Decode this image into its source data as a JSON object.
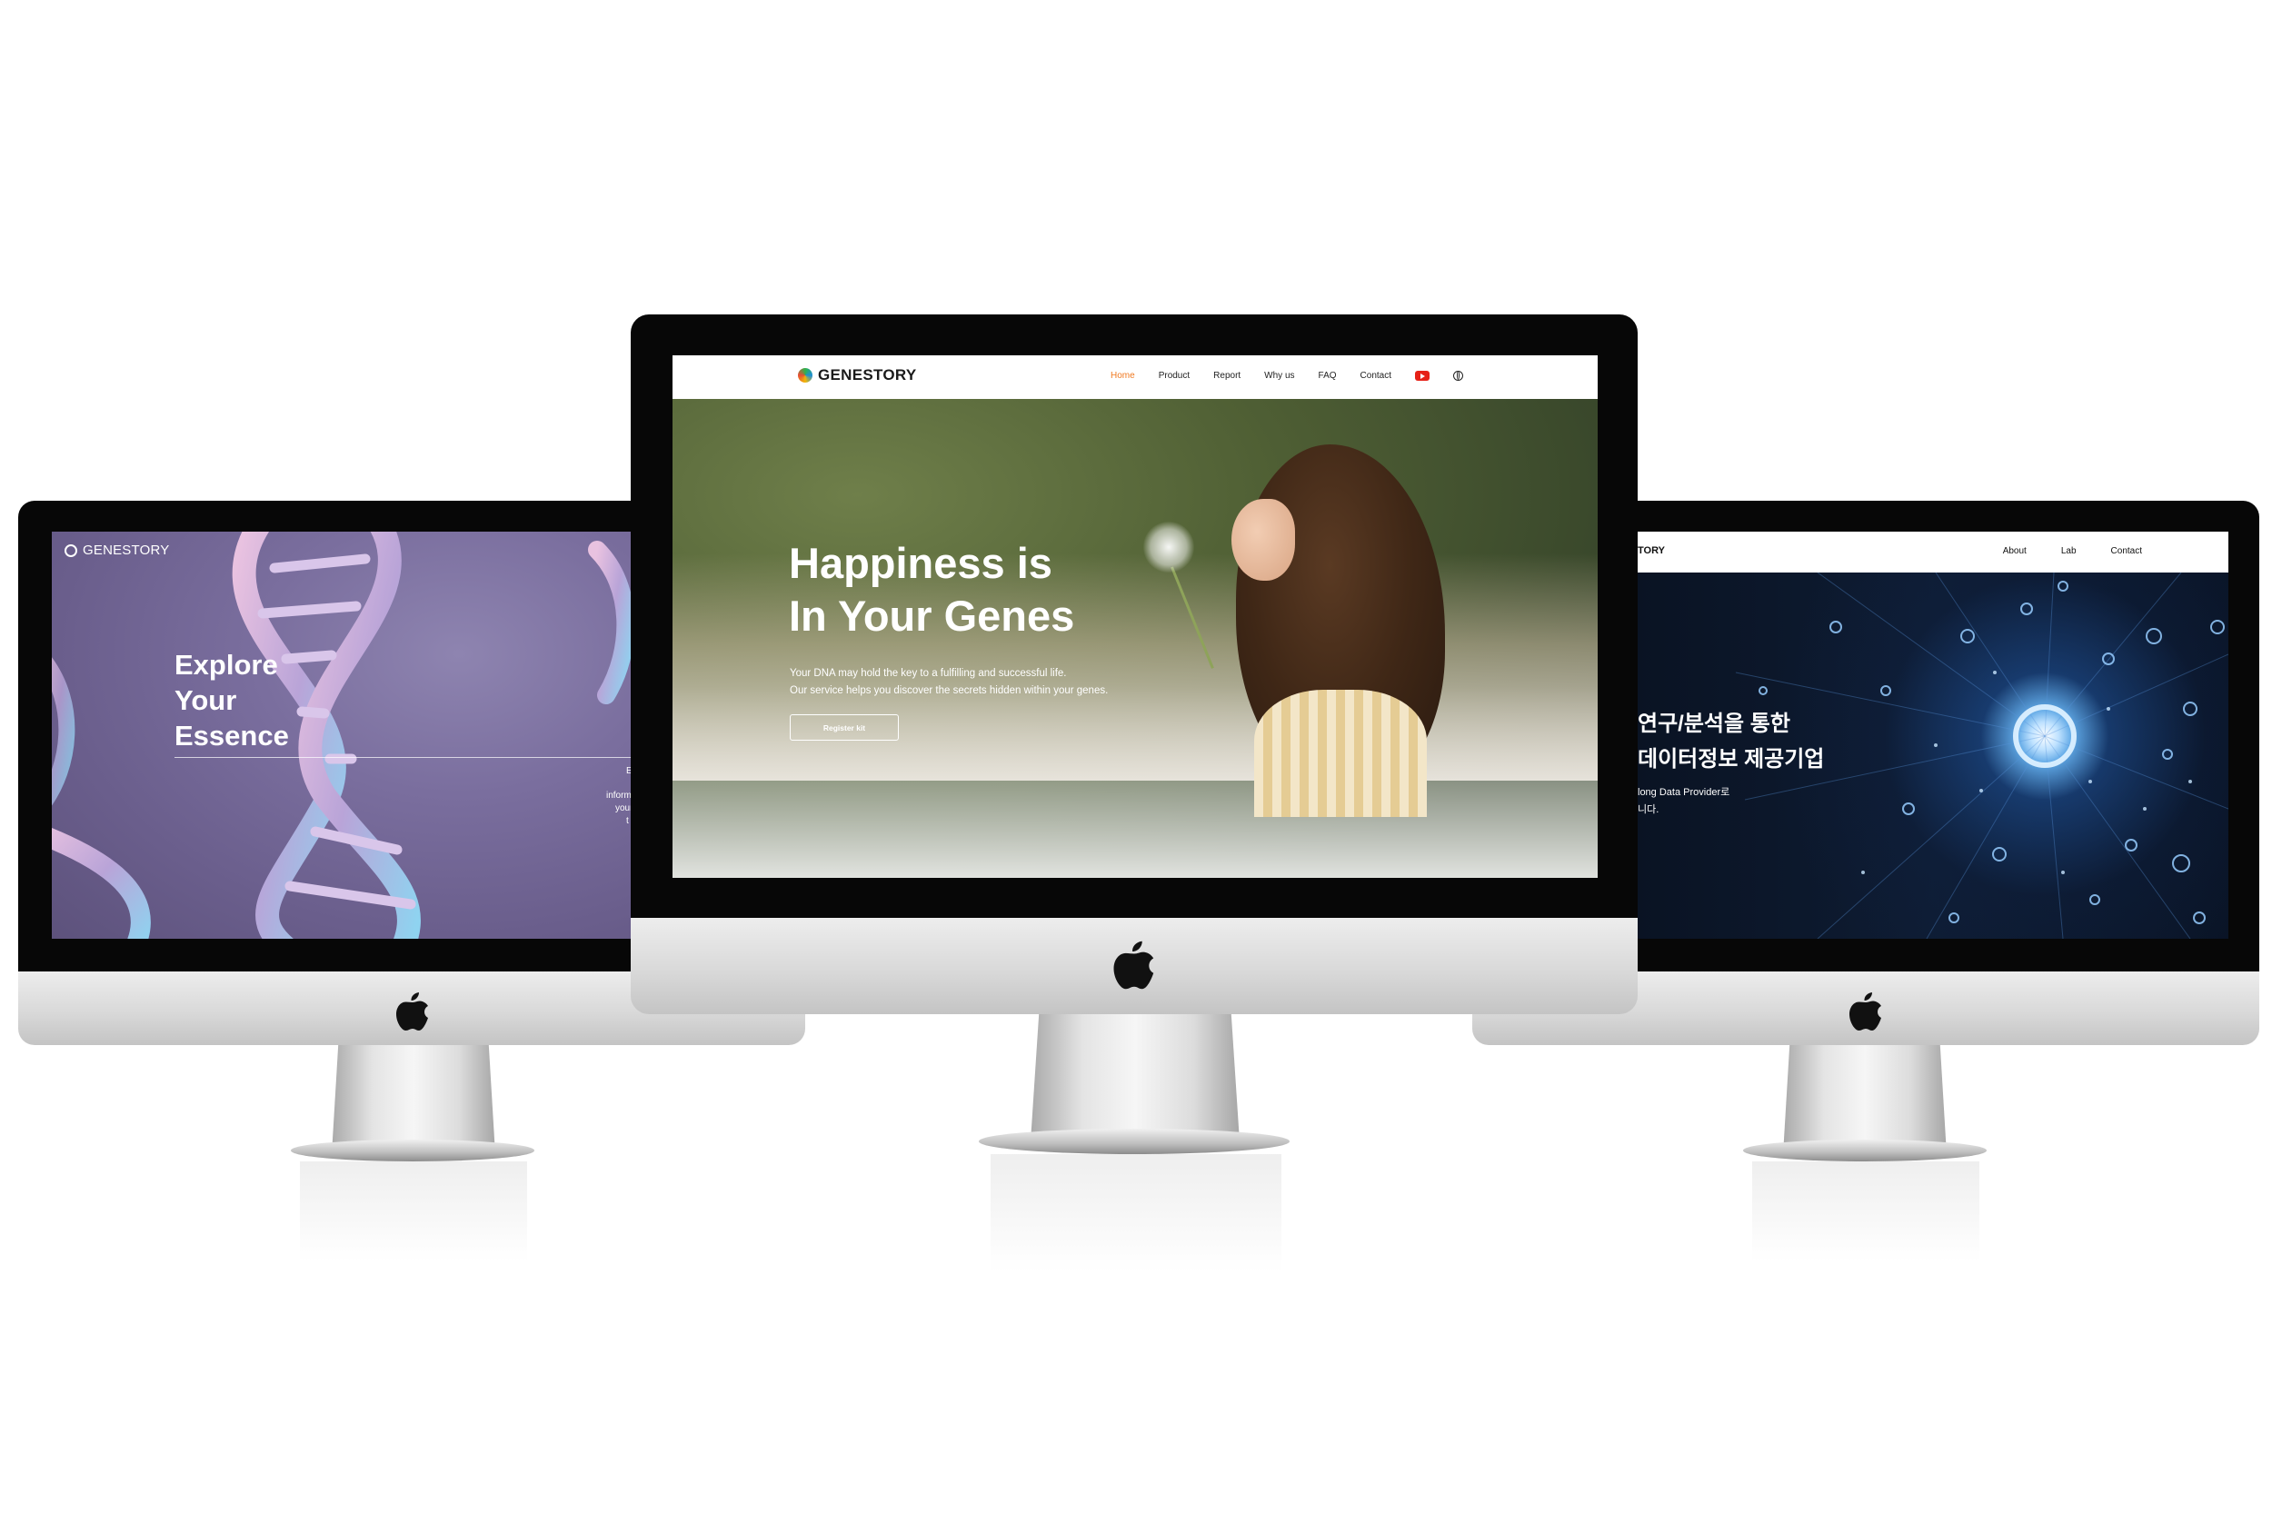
{
  "left_site": {
    "brand": "GENESTORY",
    "hero_lines": [
      "Explore",
      "Your",
      "Essence"
    ],
    "fragment_1": "E",
    "fragment_2": "inform",
    "fragment_3": "your",
    "fragment_4": "t"
  },
  "center_site": {
    "brand": "GENESTORY",
    "nav": [
      "Home",
      "Product",
      "Report",
      "Why us",
      "FAQ",
      "Contact"
    ],
    "active_nav": "Home",
    "hero_title_1": "Happiness is",
    "hero_title_2": "In Your Genes",
    "hero_sub_1": "Your DNA may hold the key to a fulfilling and successful life.",
    "hero_sub_2": "Our service helps you discover the secrets hidden within your genes.",
    "cta": "Register kit",
    "accent_color": "#f07a22"
  },
  "right_site": {
    "brand": "TORY",
    "nav": [
      "About",
      "Lab",
      "Contact"
    ],
    "hero_title_1": "연구/분석을 통한",
    "hero_title_2": "데이터정보 제공기업",
    "hero_sub_1": "long Data Provider로",
    "hero_sub_2": "니다."
  },
  "icons": [
    "apple-logo-icon",
    "youtube-icon",
    "globe-icon"
  ]
}
